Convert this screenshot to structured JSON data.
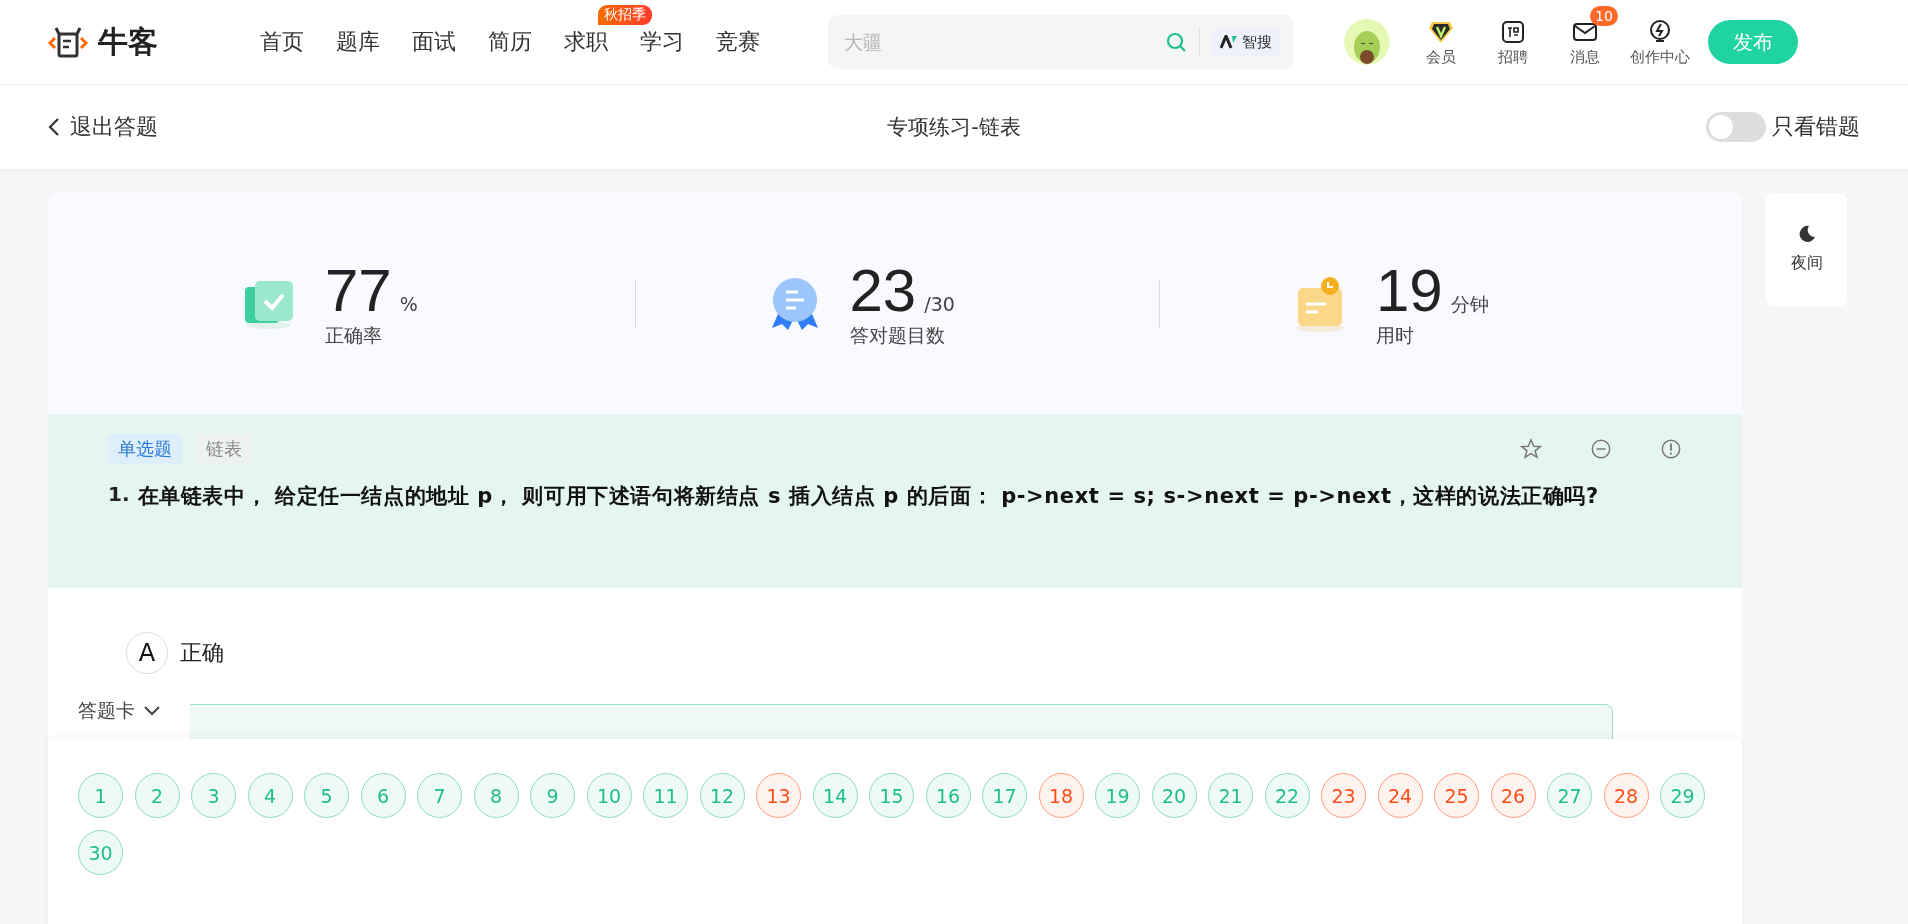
{
  "header": {
    "logo_text": "牛客",
    "nav": [
      {
        "label": "首页"
      },
      {
        "label": "题库"
      },
      {
        "label": "面试"
      },
      {
        "label": "简历"
      },
      {
        "label": "求职",
        "badge": "秋招季"
      },
      {
        "label": "学习"
      },
      {
        "label": "竞赛"
      }
    ],
    "search": {
      "placeholder": "大疆",
      "ai_label": "智搜"
    },
    "actions": [
      {
        "kind": "vip",
        "label": "会员"
      },
      {
        "kind": "recruit",
        "label": "招聘"
      },
      {
        "kind": "mail",
        "label": "消息",
        "badge": "10"
      },
      {
        "kind": "create",
        "label": "创作中心"
      }
    ],
    "publish": "发布"
  },
  "subheader": {
    "back": "退出答题",
    "title": "专项练习-链表",
    "wrong_only": {
      "label": "只看错题",
      "on": false
    }
  },
  "stats": [
    {
      "kind": "rate",
      "value": "77",
      "unit": "%",
      "label": "正确率"
    },
    {
      "kind": "count",
      "value": "23",
      "unit": "/30",
      "label": "答对题目数"
    },
    {
      "kind": "time",
      "value": "19",
      "unit": "分钟",
      "label": "用时"
    }
  ],
  "night": "夜间",
  "question": {
    "type": "单选题",
    "tag": "链表",
    "number": "1.",
    "text": "在单链表中， 给定任一结点的地址 p， 则可用下述语句将新结点 s 插入结点 p 的后面： p->next = s; s->next = p->next，这样的说法正确吗?",
    "options": [
      {
        "letter": "A",
        "text": "正确"
      }
    ]
  },
  "answer_card": {
    "label": "答题卡",
    "items": [
      {
        "n": "1",
        "correct": true
      },
      {
        "n": "2",
        "correct": true
      },
      {
        "n": "3",
        "correct": true
      },
      {
        "n": "4",
        "correct": true
      },
      {
        "n": "5",
        "correct": true
      },
      {
        "n": "6",
        "correct": true
      },
      {
        "n": "7",
        "correct": true
      },
      {
        "n": "8",
        "correct": true
      },
      {
        "n": "9",
        "correct": true
      },
      {
        "n": "10",
        "correct": true
      },
      {
        "n": "11",
        "correct": true
      },
      {
        "n": "12",
        "correct": true
      },
      {
        "n": "13",
        "correct": false
      },
      {
        "n": "14",
        "correct": true
      },
      {
        "n": "15",
        "correct": true
      },
      {
        "n": "16",
        "correct": true
      },
      {
        "n": "17",
        "correct": true
      },
      {
        "n": "18",
        "correct": false
      },
      {
        "n": "19",
        "correct": true
      },
      {
        "n": "20",
        "correct": true
      },
      {
        "n": "21",
        "correct": true
      },
      {
        "n": "22",
        "correct": true
      },
      {
        "n": "23",
        "correct": false
      },
      {
        "n": "24",
        "correct": false
      },
      {
        "n": "25",
        "correct": false
      },
      {
        "n": "26",
        "correct": false
      },
      {
        "n": "27",
        "correct": true
      },
      {
        "n": "28",
        "correct": false
      },
      {
        "n": "29",
        "correct": true
      },
      {
        "n": "30",
        "correct": true
      }
    ]
  }
}
